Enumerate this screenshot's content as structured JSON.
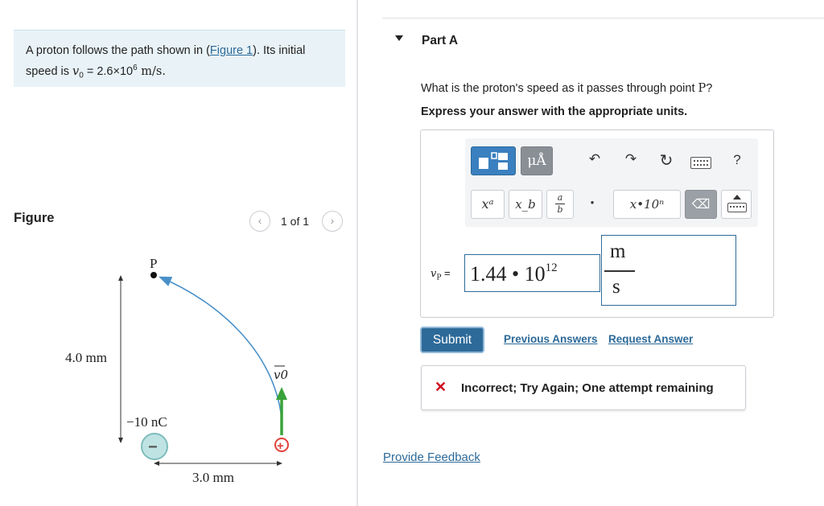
{
  "problem": {
    "text_before": "A proton follows the path shown in (",
    "figure_link": "Figure 1",
    "text_after": "). Its initial",
    "line2_prefix": "speed is ",
    "v0_symbol": "v",
    "v0_sub": "0",
    "v0_equals": " = 2.6×10",
    "v0_exp": "6",
    "v0_unit": " m/s."
  },
  "figure": {
    "title": "Figure",
    "pager_text": "1 of 1",
    "prev_icon": "‹",
    "next_icon": "›",
    "point_label": "P",
    "height_label": "4.0 mm",
    "charge_label": "−10 nC",
    "width_label": "3.0 mm",
    "velocity_label": "v0",
    "negative_sign": "−",
    "positive_sign": "+",
    "colors": {
      "path": "#4a90c8",
      "velocity": "#3aa23a",
      "negative_charge": "#bfe3e3",
      "positive_charge": "#e0413a"
    }
  },
  "part": {
    "toggle_icon": "triangle-down-icon",
    "title": "Part A",
    "question_prefix": "What is the proton's speed as it passes through point ",
    "question_point": "P",
    "question_suffix": "?",
    "instruction": "Express your answer with the appropriate units."
  },
  "toolbar": {
    "units_label": "μÅ",
    "undo_icon": "↶",
    "redo_icon": "↷",
    "reset_icon": "↻",
    "help_label": "?",
    "superscript_label": "xᵃ",
    "subscript_label": "x_b",
    "fraction_num": "a",
    "fraction_den": "b",
    "dot_label": "•",
    "sci_label": "x•10ⁿ",
    "backspace_icon": "⌫"
  },
  "answer": {
    "variable": "v",
    "variable_sub": "P",
    "equals": " =",
    "value_mantissa": "1.44 • 10",
    "value_exponent": "12",
    "unit_numerator": "m",
    "unit_denominator": "s"
  },
  "actions": {
    "submit_label": "Submit",
    "previous_answers": "Previous Answers",
    "request_answer": "Request Answer"
  },
  "feedback": {
    "icon": "✕",
    "message": "Incorrect; Try Again; One attempt remaining",
    "color": "#d0021b"
  },
  "footer": {
    "provide_feedback": "Provide Feedback"
  }
}
